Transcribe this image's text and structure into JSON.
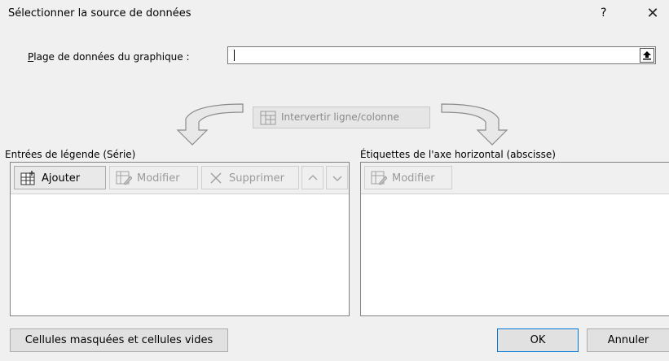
{
  "window": {
    "title": "Sélectionner la source de données",
    "help": "?",
    "close": "✕"
  },
  "range": {
    "label": "Plage de données du graphique :",
    "value": ""
  },
  "switch_button": {
    "label": "Intervertir ligne/colonne"
  },
  "legend": {
    "label": "Entrées de légende (Série)",
    "add": "Ajouter",
    "edit": "Modifier",
    "remove": "Supprimer",
    "up": "⌃",
    "down": "⌄"
  },
  "axis": {
    "label": "Étiquettes de l'axe horizontal (abscisse)",
    "edit": "Modifier"
  },
  "footer": {
    "hidden_cells": "Cellules masquées et cellules vides",
    "ok": "OK",
    "cancel": "Annuler"
  },
  "colors": {
    "background": "#f0f0f0",
    "disabled_text": "#9a9a9a",
    "border": "#828282"
  }
}
